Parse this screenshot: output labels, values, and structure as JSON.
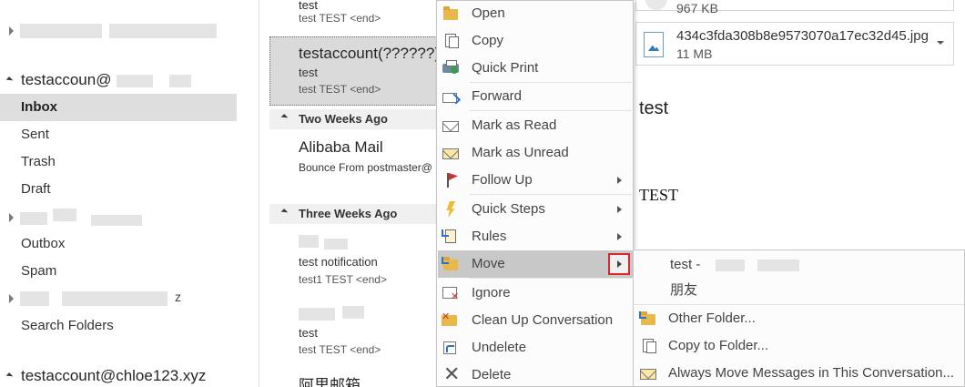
{
  "folder_pane": {
    "account1": "testaccoun@",
    "inbox": "Inbox",
    "sent": "Sent",
    "trash": "Trash",
    "draft": "Draft",
    "outbox": "Outbox",
    "spam": "Spam",
    "collapsed_suffix": "z",
    "search_folders": "Search Folders",
    "account2": "testaccount@chloe123.xyz"
  },
  "message_list": {
    "top_item": {
      "from": "test",
      "preview": "test  TEST <end>"
    },
    "selected_item": {
      "from": "testaccount(??????)",
      "subject": "test",
      "preview": "test  TEST <end>"
    },
    "group_two_weeks": "Two Weeks Ago",
    "alibaba_item": {
      "from": "Alibaba Mail",
      "subject": "Bounce From postmaster@"
    },
    "group_three_weeks": "Three Weeks Ago",
    "notif_item": {
      "subject": "test notification",
      "preview": "test1  TEST <end>"
    },
    "test_item": {
      "subject": "test",
      "preview": "test  TEST <end>"
    },
    "last_item": {
      "from": "阿里邮箱"
    }
  },
  "reading_pane": {
    "attachment_top_size": "967 KB",
    "attachment_name": "434c3fda308b8e9573070a17ec32d45.jpg",
    "attachment_size": "11 MB",
    "body_line1": "test",
    "body_line2": "TEST"
  },
  "context_menu": {
    "open": "Open",
    "copy": "Copy",
    "quick_print": "Quick Print",
    "forward": "Forward",
    "mark_read": "Mark as Read",
    "mark_unread": "Mark as Unread",
    "follow_up": "Follow Up",
    "quick_steps": "Quick Steps",
    "rules": "Rules",
    "move": "Move",
    "ignore": "Ignore",
    "clean_up": "Clean Up Conversation",
    "undelete": "Undelete",
    "delete": "Delete"
  },
  "move_submenu": {
    "recent1": "test -",
    "recent2": "朋友",
    "other_folder": "Other Folder...",
    "copy_to_folder": "Copy to Folder...",
    "always_move": "Always Move Messages in This Conversation..."
  },
  "colors": {
    "highlight": "#c8c8c8",
    "selection": "#dedede",
    "submenu_box_border": "#e0262b",
    "accent_blue": "#2a73c0"
  }
}
